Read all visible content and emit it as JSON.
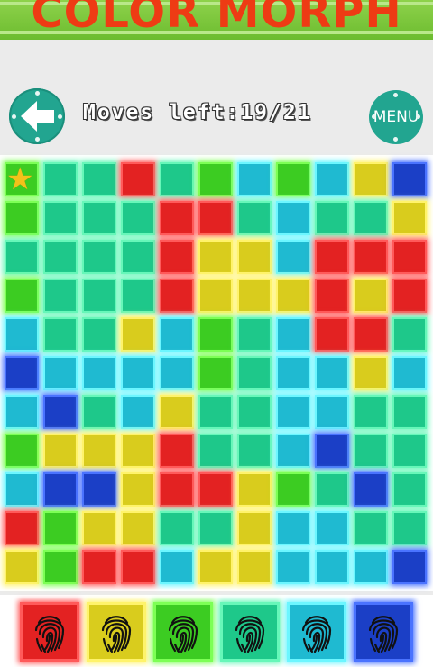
{
  "header": {
    "title": "COLOR MORPH"
  },
  "controls": {
    "moves_label": "Moves left:19/21",
    "menu_label": "MENU"
  },
  "colors": {
    "R": "#e32222",
    "Y": "#d9cc1d",
    "G": "#3ccc22",
    "T": "#1ec88a",
    "C": "#1fbad1",
    "B": "#1b3fc6"
  },
  "glow": {
    "R": "#ff5a5a",
    "Y": "#fff36b",
    "G": "#7dff55",
    "T": "#67f7b9",
    "C": "#6cf6ff",
    "B": "#4a73ff"
  },
  "board": {
    "rows": [
      [
        "G",
        "T",
        "T",
        "R",
        "T",
        "G",
        "C",
        "G",
        "C",
        "Y",
        "B"
      ],
      [
        "G",
        "T",
        "T",
        "T",
        "R",
        "R",
        "T",
        "C",
        "T",
        "T",
        "Y"
      ],
      [
        "T",
        "T",
        "T",
        "T",
        "R",
        "Y",
        "Y",
        "C",
        "R",
        "R",
        "R"
      ],
      [
        "G",
        "T",
        "T",
        "T",
        "R",
        "Y",
        "Y",
        "Y",
        "R",
        "Y",
        "R"
      ],
      [
        "C",
        "T",
        "T",
        "Y",
        "C",
        "G",
        "T",
        "C",
        "R",
        "R",
        "T"
      ],
      [
        "B",
        "C",
        "C",
        "C",
        "C",
        "G",
        "T",
        "C",
        "C",
        "Y",
        "C"
      ],
      [
        "C",
        "B",
        "T",
        "C",
        "Y",
        "T",
        "T",
        "C",
        "C",
        "T",
        "T"
      ],
      [
        "G",
        "Y",
        "Y",
        "Y",
        "R",
        "T",
        "T",
        "C",
        "B",
        "T",
        "T"
      ],
      [
        "C",
        "B",
        "B",
        "Y",
        "R",
        "R",
        "Y",
        "G",
        "T",
        "B",
        "T"
      ],
      [
        "R",
        "G",
        "Y",
        "Y",
        "T",
        "T",
        "Y",
        "C",
        "C",
        "T",
        "T"
      ],
      [
        "Y",
        "G",
        "R",
        "R",
        "C",
        "Y",
        "Y",
        "C",
        "C",
        "C",
        "B"
      ]
    ],
    "star_icon": "star-icon"
  },
  "palette": {
    "buttons": [
      {
        "color": "R",
        "icon": "fingerprint-icon"
      },
      {
        "color": "Y",
        "icon": "fingerprint-icon"
      },
      {
        "color": "G",
        "icon": "fingerprint-icon"
      },
      {
        "color": "T",
        "icon": "fingerprint-icon"
      },
      {
        "color": "C",
        "icon": "fingerprint-icon"
      },
      {
        "color": "B",
        "icon": "fingerprint-icon"
      }
    ]
  }
}
